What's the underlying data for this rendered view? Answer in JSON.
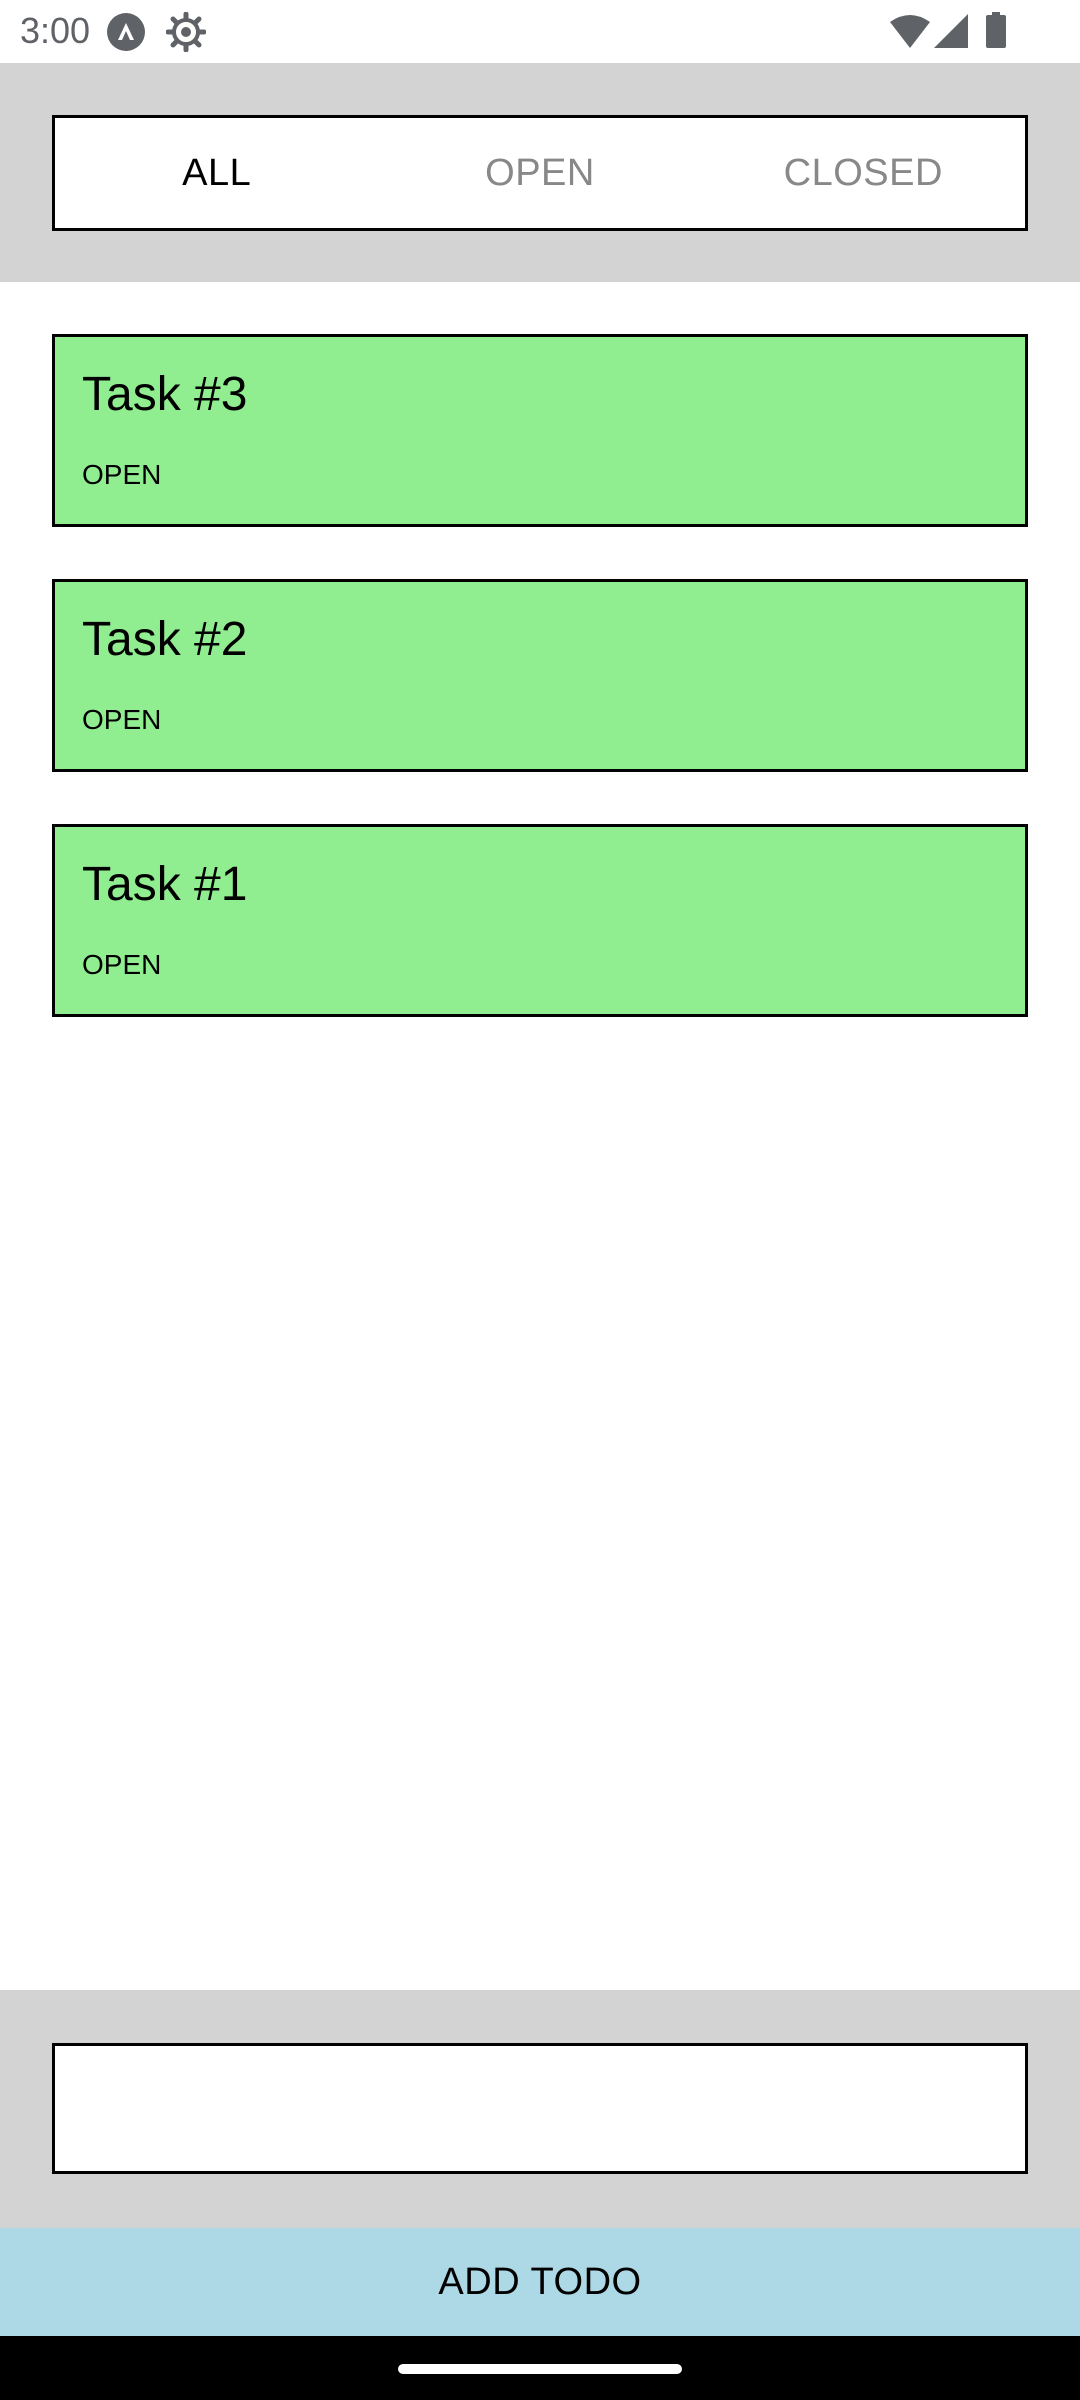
{
  "status_bar": {
    "time": "3:00",
    "icons": [
      "app-notification-icon",
      "gear-icon",
      "wifi-icon",
      "cell-signal-icon",
      "battery-icon"
    ]
  },
  "filter": {
    "tabs": [
      {
        "label": "ALL",
        "selected": true
      },
      {
        "label": "OPEN",
        "selected": false
      },
      {
        "label": "CLOSED",
        "selected": false
      }
    ]
  },
  "tasks": [
    {
      "title": "Task #3",
      "status": "OPEN"
    },
    {
      "title": "Task #2",
      "status": "OPEN"
    },
    {
      "title": "Task #1",
      "status": "OPEN"
    }
  ],
  "new_todo": {
    "value": "",
    "placeholder": ""
  },
  "add_button": {
    "label": "ADD TODO"
  },
  "colors": {
    "task_background": "#90ee90",
    "panel_background": "#d3d3d3",
    "add_button_background": "#add8e6",
    "inactive_tab_text": "#888888"
  }
}
